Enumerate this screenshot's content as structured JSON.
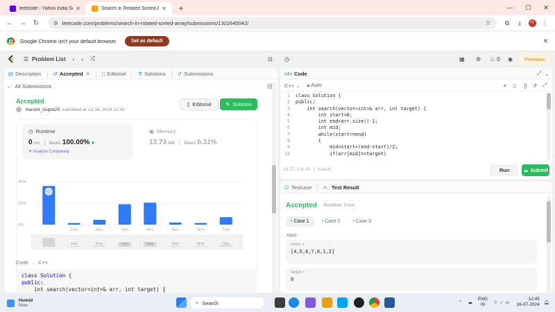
{
  "browser": {
    "tabs": [
      {
        "title": "leetcode - Yahoo India Search R",
        "active": false,
        "favicon_color": "#6001d2"
      },
      {
        "title": "Search in Rotated Sorted Array",
        "active": true,
        "favicon_color": "#ffa116"
      }
    ],
    "url": "leetcode.com/problems/search-in-rotated-sorted-array/submissions/1322640042/",
    "infobar_text": "Google Chrome isn't your default browser",
    "infobar_button": "Set as default",
    "profile_initial": "H"
  },
  "leetcode": {
    "nav": {
      "problem_list": "Problem List",
      "streak": "0",
      "premium": "Premium"
    },
    "left_tabs": [
      "Description",
      "Accepted",
      "Editorial",
      "Solutions",
      "Submissions"
    ],
    "all_submissions": "All Submissions",
    "status": "Accepted",
    "author": "Harshit_Gupta25",
    "submitted_text": "submitted at Jul 16, 2024 12:45",
    "editorial_btn": "Editorial",
    "solution_btn": "Solution",
    "runtime": {
      "label": "Runtime",
      "value": "0",
      "unit": "ms",
      "beats_label": "Beats",
      "beats_value": "100.00%",
      "analyze": "Analyze Complexity"
    },
    "memory": {
      "label": "Memory",
      "value": "13.73",
      "unit": "MB",
      "beats_label": "Beats",
      "beats_value": "6.31%"
    },
    "code_section_label": "Code",
    "code_lang": "C++",
    "code_preview_lines": [
      "class Solution {",
      "public:",
      "    int search(vector<int>& arr, int target) {"
    ]
  },
  "editor": {
    "title": "Code",
    "lang": "C++",
    "mode": "Auto",
    "lines": [
      "class Solution {",
      "public:",
      "    int search(vector<int>& arr, int target) {",
      "        int start=0;",
      "        int end=arr.size()-1;",
      "        int mid;",
      "        while(start<=end)",
      "        {",
      "            mid=start+(end-start)/2;",
      "            if(arr[mid]==target)"
    ],
    "status": "Ln 27, Col 49",
    "saved": "Saved",
    "run_label": "Run",
    "submit_label": "Submit"
  },
  "result": {
    "tab_testcase": "Testcase",
    "tab_result": "Test Result",
    "status": "Accepted",
    "runtime_text": "Runtime: 0 ms",
    "cases": [
      "Case 1",
      "Case 2",
      "Case 3"
    ],
    "input_label": "Input",
    "fields": [
      {
        "name": "nums =",
        "value": "[4,5,6,7,0,1,2]"
      },
      {
        "name": "target =",
        "value": "0"
      }
    ]
  },
  "chart_data": {
    "type": "bar",
    "title": "",
    "categories": [
      "0ms",
      "1ms",
      "2ms",
      "3ms",
      "4ms",
      "5ms",
      "6ms",
      "7ms"
    ],
    "tick_labels_shown": [
      "",
      "1ms",
      "2ms",
      "3ms",
      "4ms",
      "5ms",
      "6ms",
      "7ms"
    ],
    "values": [
      36,
      1.5,
      4.5,
      19,
      20.5,
      2,
      1.5,
      7
    ],
    "highlighted_index": 0,
    "y_ticks": [
      "40%",
      "20%",
      "0%"
    ],
    "ylim": [
      0,
      40
    ],
    "bar_color": "#2f7bf5",
    "xlabel": "",
    "ylabel": "",
    "grid": true
  },
  "taskbar": {
    "weather_title": "Humid",
    "weather_sub": "Now",
    "search_placeholder": "Search",
    "lang": "ENG",
    "region": "IN",
    "time": "12:45",
    "date": "16-07-2024"
  }
}
